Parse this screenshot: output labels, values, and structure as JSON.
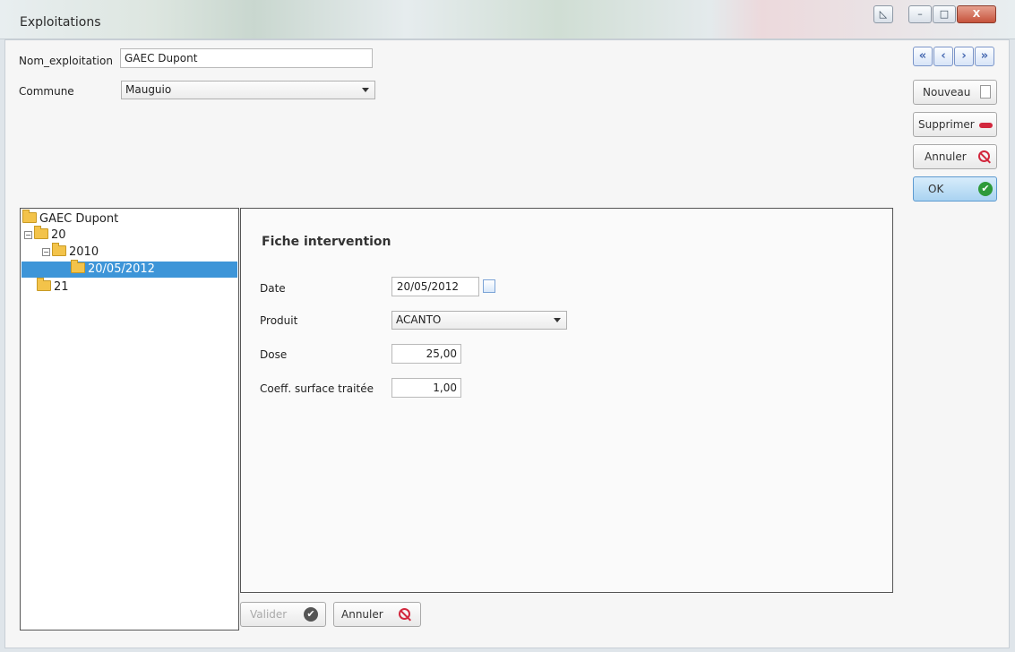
{
  "window": {
    "title": "Exploitations",
    "controls": {
      "help": "◺",
      "minimize": "–",
      "maximize": "□",
      "close": "X"
    }
  },
  "form": {
    "nom_label": "Nom_exploitation",
    "nom_value": "GAEC Dupont",
    "commune_label": "Commune",
    "commune_value": "Mauguio"
  },
  "nav": {
    "first": "«",
    "prev": "‹",
    "next": "›",
    "last": "»"
  },
  "actions": {
    "nouveau": "Nouveau",
    "supprimer": "Supprimer",
    "annuler": "Annuler",
    "ok": "OK"
  },
  "tree": {
    "root": "GAEC Dupont",
    "n20": "20",
    "n2010": "2010",
    "selected": "20/05/2012",
    "n21": "21"
  },
  "fiche": {
    "title": "Fiche intervention",
    "date_label": "Date",
    "date_value": "20/05/2012",
    "produit_label": "Produit",
    "produit_value": "ACANTO",
    "dose_label": "Dose",
    "dose_value": "25,00",
    "coeff_label": "Coeff. surface traitée",
    "coeff_value": "1,00"
  },
  "bottom": {
    "valider": "Valider",
    "annuler": "Annuler"
  },
  "colors": {
    "selection": "#3d95d8",
    "ok_bg": "#bfe0f7",
    "check_green": "#2e9a3a",
    "danger": "#d2273d"
  }
}
